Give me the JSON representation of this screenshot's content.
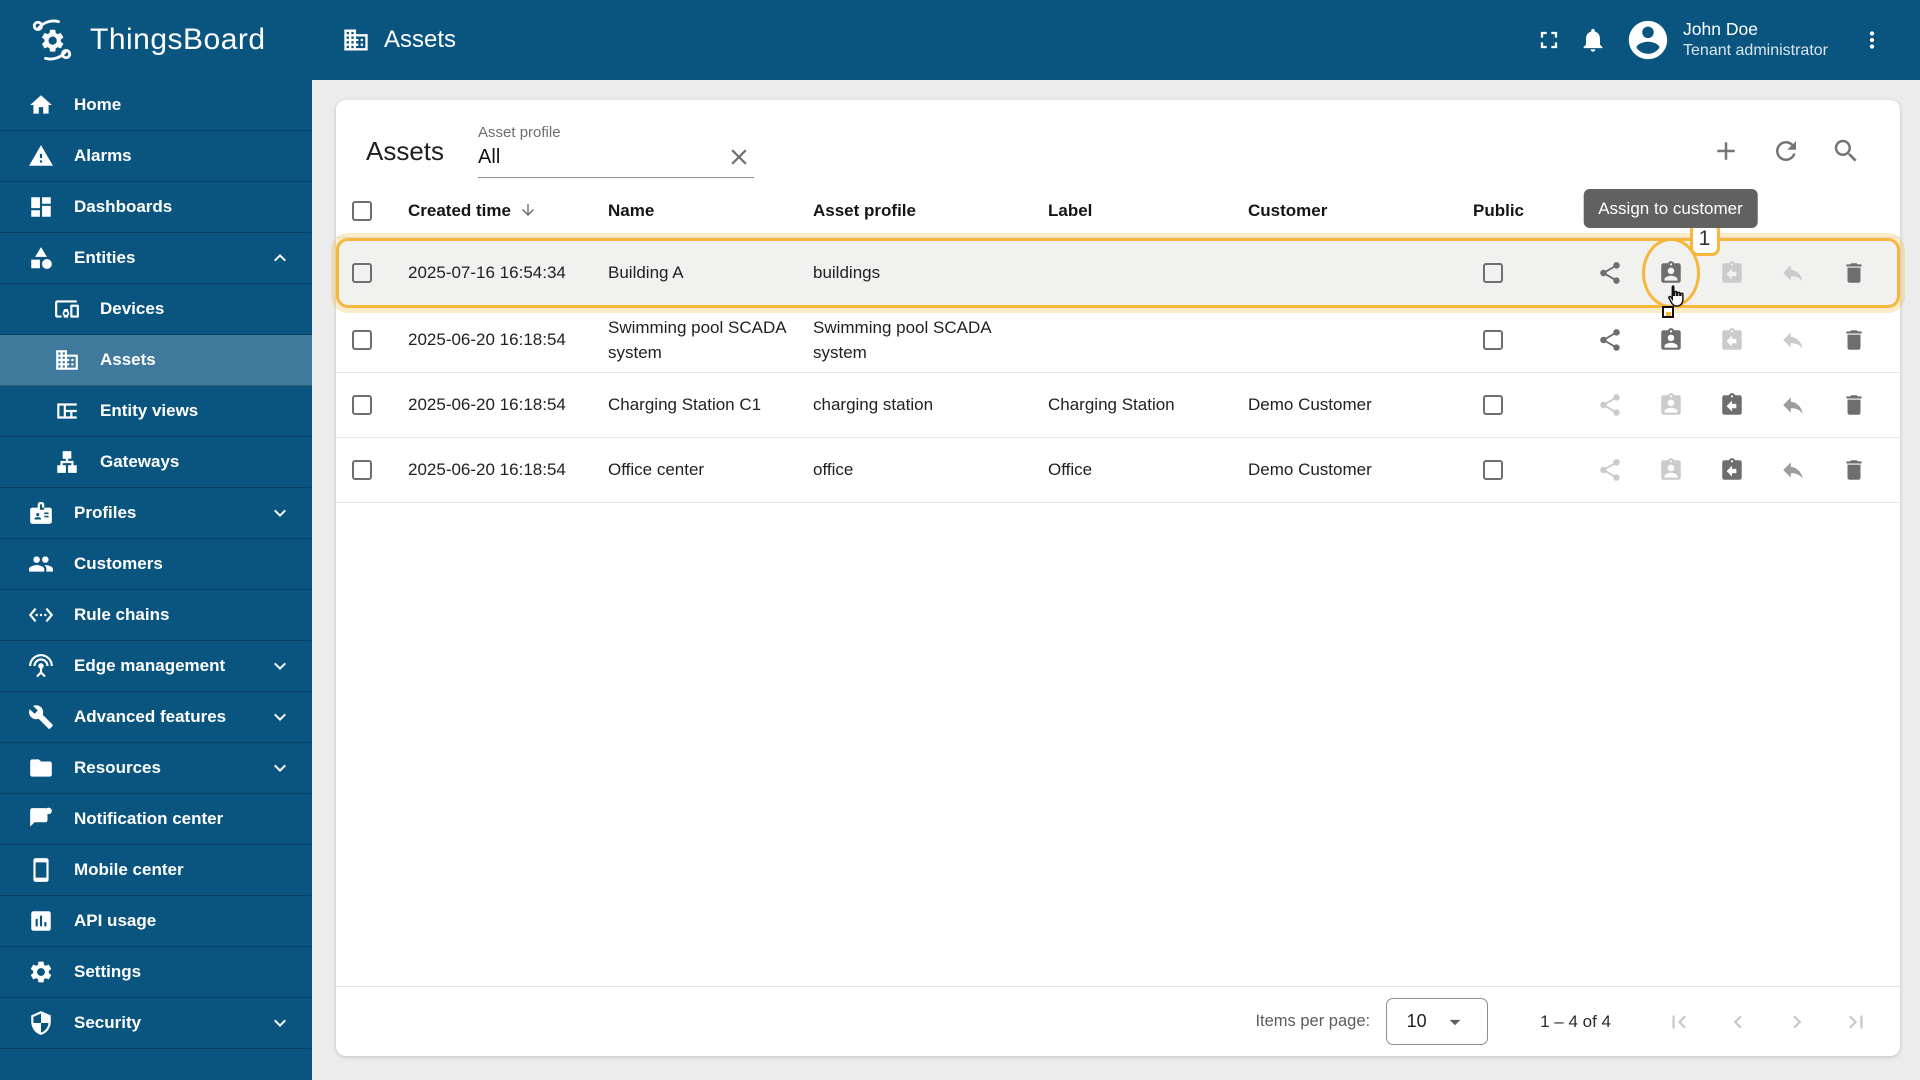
{
  "colors": {
    "primary": "#0a5580",
    "accent": "#f6b73c",
    "tooltip_bg": "#616161",
    "page_bg": "#ececec"
  },
  "topbar": {
    "app_name": "ThingsBoard",
    "page_title": "Assets",
    "user_name": "John Doe",
    "user_role": "Tenant administrator"
  },
  "sidebar": {
    "items": [
      {
        "label": "Home",
        "icon": "home"
      },
      {
        "label": "Alarms",
        "icon": "alarms"
      },
      {
        "label": "Dashboards",
        "icon": "dashboards"
      },
      {
        "label": "Entities",
        "icon": "entities",
        "chevron": "up"
      },
      {
        "label": "Devices",
        "icon": "devices",
        "sub": true
      },
      {
        "label": "Assets",
        "icon": "assets",
        "sub": true,
        "active": true
      },
      {
        "label": "Entity views",
        "icon": "entity-views",
        "sub": true
      },
      {
        "label": "Gateways",
        "icon": "gateways",
        "sub": true
      },
      {
        "label": "Profiles",
        "icon": "profiles",
        "chevron": "down"
      },
      {
        "label": "Customers",
        "icon": "customers"
      },
      {
        "label": "Rule chains",
        "icon": "rule-chains"
      },
      {
        "label": "Edge management",
        "icon": "edge-management",
        "chevron": "down"
      },
      {
        "label": "Advanced features",
        "icon": "advanced-features",
        "chevron": "down"
      },
      {
        "label": "Resources",
        "icon": "resources",
        "chevron": "down"
      },
      {
        "label": "Notification center",
        "icon": "notification-center"
      },
      {
        "label": "Mobile center",
        "icon": "mobile-center"
      },
      {
        "label": "API usage",
        "icon": "api-usage"
      },
      {
        "label": "Settings",
        "icon": "settings"
      },
      {
        "label": "Security",
        "icon": "security",
        "chevron": "down"
      }
    ]
  },
  "main": {
    "title": "Assets",
    "filter_label": "Asset profile",
    "filter_value": "All",
    "tooltip": "Assign to customer",
    "badge": "1",
    "table": {
      "columns": [
        "Created time",
        "Name",
        "Asset profile",
        "Label",
        "Customer",
        "Public"
      ],
      "sorted_column": "Created time",
      "rows": [
        {
          "created": "2025-07-16 16:54:34",
          "name": "Building A",
          "profile": "buildings",
          "label": "",
          "customer": "",
          "public_checked": false,
          "highlighted": true,
          "actions": {
            "make_public": 2,
            "assign": 2,
            "unassign": 0,
            "make_private": 0,
            "delete": 2
          }
        },
        {
          "created": "2025-06-20 16:18:54",
          "name": "Swimming pool SCADA system",
          "profile": "Swimming pool SCADA system",
          "label": "",
          "customer": "",
          "public_checked": false,
          "highlighted": false,
          "actions": {
            "make_public": 2,
            "assign": 2,
            "unassign": 0,
            "make_private": 0,
            "delete": 2
          }
        },
        {
          "created": "2025-06-20 16:18:54",
          "name": "Charging Station C1",
          "profile": "charging station",
          "label": "Charging Station",
          "customer": "Demo Customer",
          "public_checked": false,
          "highlighted": false,
          "actions": {
            "make_public": 0,
            "assign": 0,
            "unassign": 2,
            "make_private": 1,
            "delete": 2
          }
        },
        {
          "created": "2025-06-20 16:18:54",
          "name": "Office center",
          "profile": "office",
          "label": "Office",
          "customer": "Demo Customer",
          "public_checked": false,
          "highlighted": false,
          "actions": {
            "make_public": 0,
            "assign": 0,
            "unassign": 2,
            "make_private": 1,
            "delete": 2
          }
        }
      ]
    },
    "paginator": {
      "items_per_page_label": "Items per page:",
      "page_size": "10",
      "range_label": "1 – 4 of 4"
    }
  }
}
